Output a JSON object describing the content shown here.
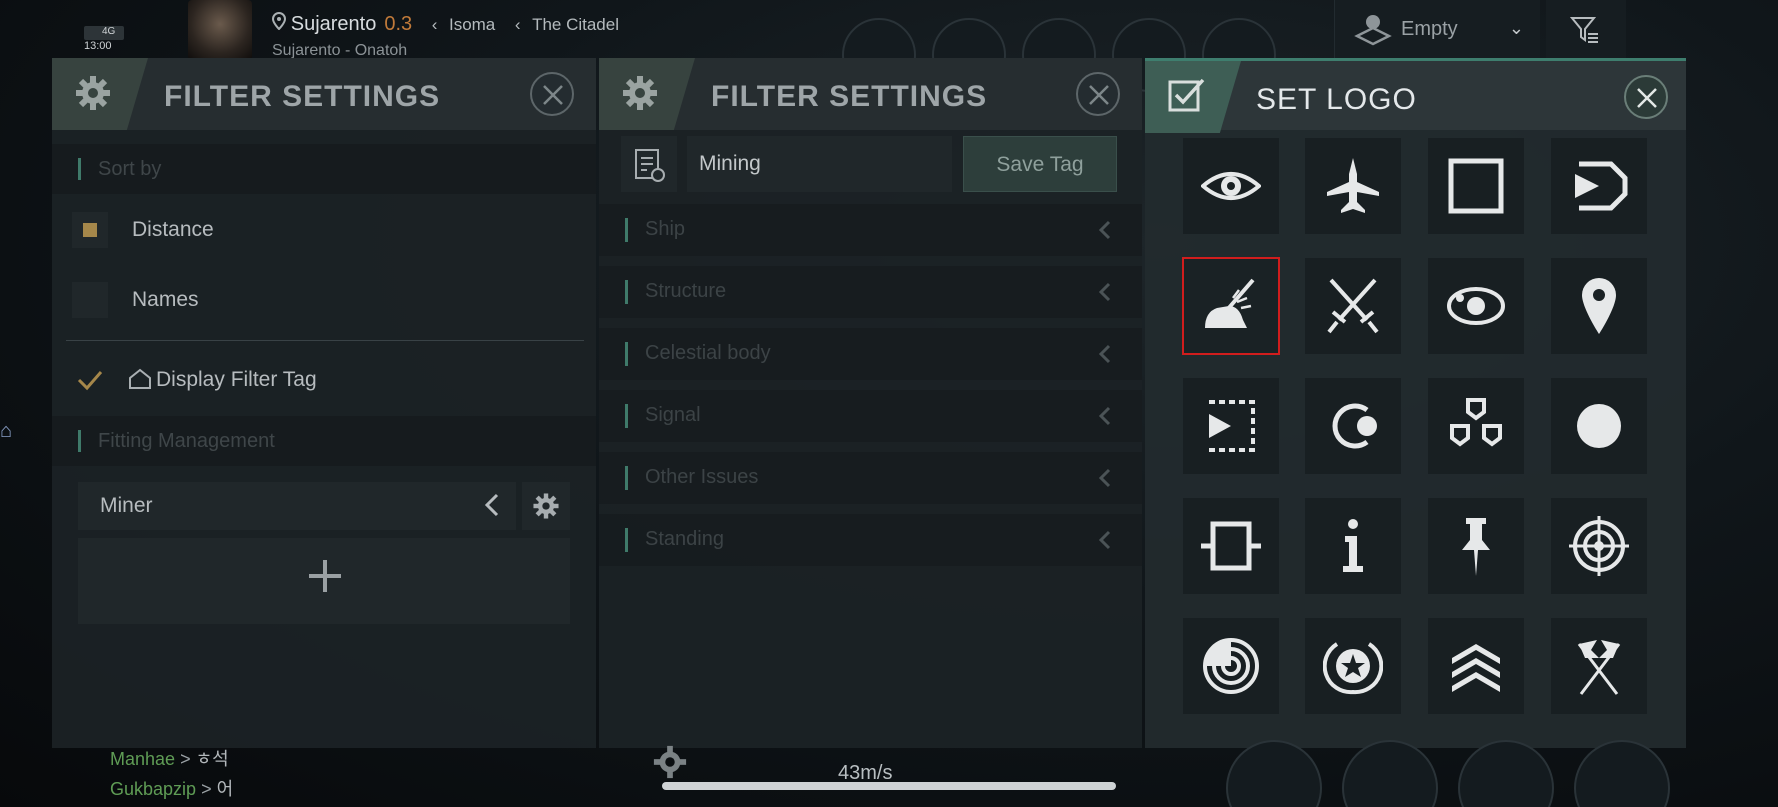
{
  "status": {
    "network": "4G",
    "time": "13:00"
  },
  "location": {
    "system": "Sujarento",
    "security": "0.3",
    "region": "Isoma",
    "constellation": "The Citadel",
    "route": "Sujarento - Onatoh"
  },
  "top_right": {
    "target_label": "Empty"
  },
  "filter_panel_1": {
    "title": "FILTER SETTINGS",
    "sort_header": "Sort by",
    "options": [
      {
        "label": "Distance",
        "checked": true
      },
      {
        "label": "Names",
        "checked": false
      }
    ],
    "display_filter_tag": "Display Filter Tag",
    "fitting_header": "Fitting Management",
    "fitting_selected": "Miner"
  },
  "filter_panel_2": {
    "title": "FILTER SETTINGS",
    "tag_name": "Mining",
    "save_label": "Save Tag",
    "categories": [
      "Ship",
      "Structure",
      "Celestial body",
      "Signal",
      "Other Issues",
      "Standing"
    ]
  },
  "set_logo_panel": {
    "title": "SET LOGO",
    "selected_index": 4,
    "logos": [
      "eye-icon",
      "fighter-jet-icon",
      "square-icon",
      "play-frame-icon",
      "mining-icon",
      "crossed-swords-icon",
      "orbit-icon",
      "map-pin-icon",
      "dashed-play-icon",
      "crescent-dot-icon",
      "triple-shield-icon",
      "circle-icon",
      "connector-box-icon",
      "info-icon",
      "pushpin-icon",
      "crosshair-icon",
      "radar-icon",
      "star-wreath-icon",
      "chevrons-up-icon",
      "crossed-flags-icon"
    ]
  },
  "chat": [
    {
      "name": "Manhae",
      "text": "ㅎ석"
    },
    {
      "name": "Gukbapzip",
      "text": "어"
    }
  ],
  "speed": "43m/s",
  "colors": {
    "accent": "#3f7a6a",
    "selection": "#d11d1d",
    "security": "#c07a3a",
    "chat_name": "#5f9c55"
  }
}
